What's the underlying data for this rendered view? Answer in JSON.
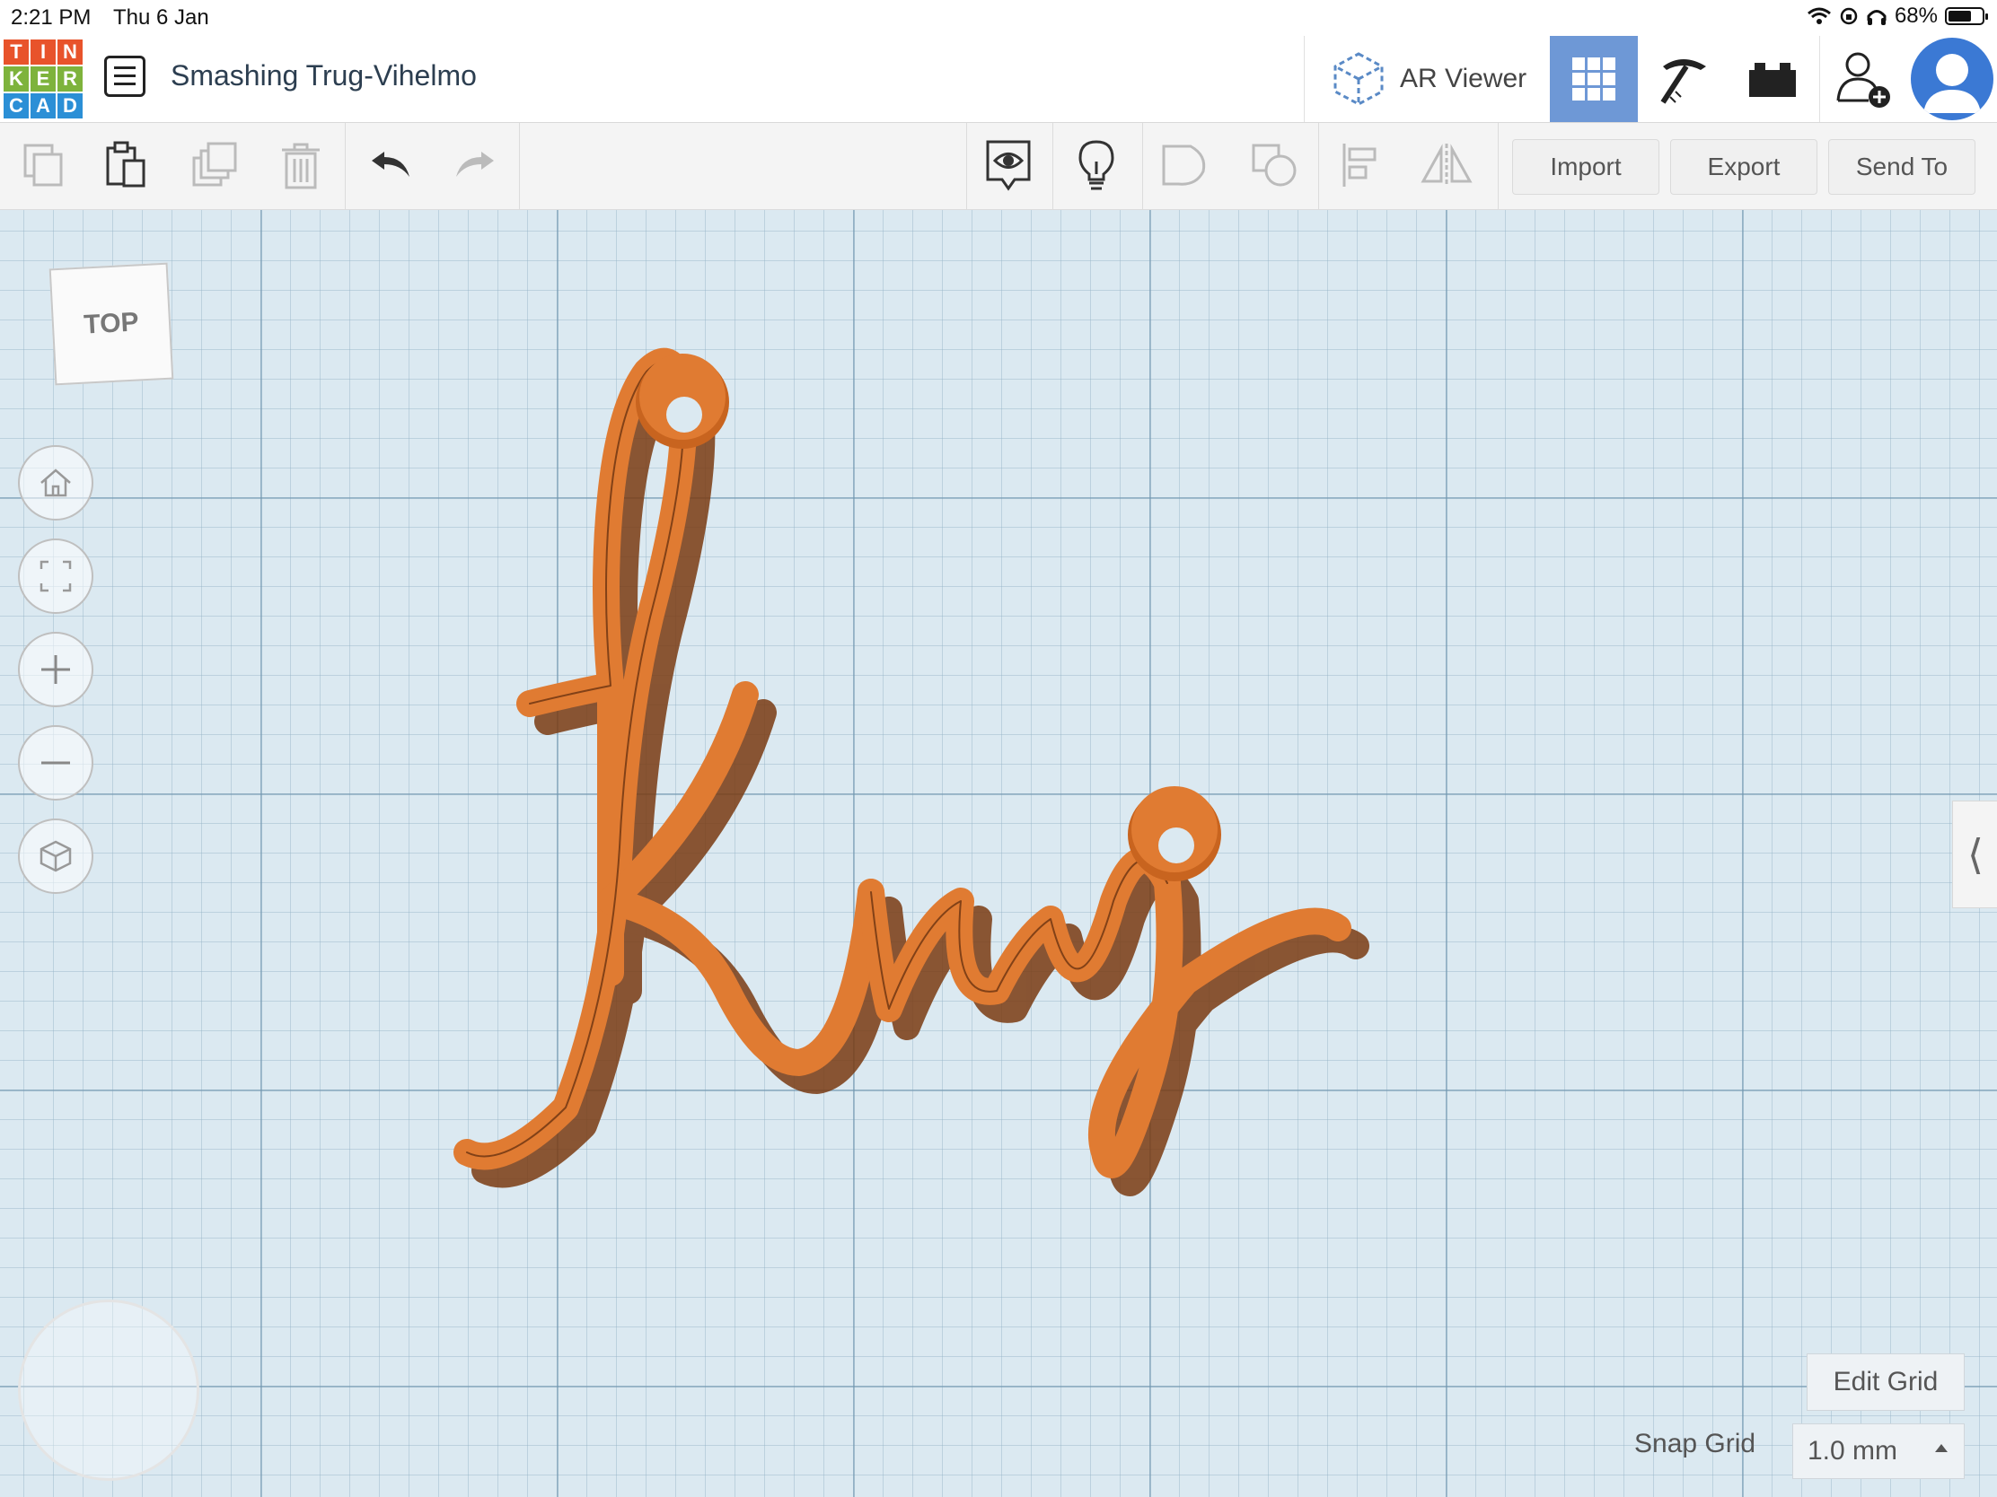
{
  "status_bar": {
    "time": "2:21 PM",
    "date": "Thu 6 Jan",
    "battery": "68%",
    "icons": [
      "wifi-icon",
      "orientation-lock-icon",
      "headphones-icon",
      "battery-icon"
    ]
  },
  "app": {
    "logo_letters": [
      "T",
      "I",
      "N",
      "K",
      "E",
      "R",
      "C",
      "A",
      "D"
    ],
    "logo_colors": [
      "#e8532b",
      "#e8532b",
      "#e8532b",
      "#7eb33c",
      "#7eb33c",
      "#7eb33c",
      "#2b8fd6",
      "#2b8fd6",
      "#2b8fd6"
    ],
    "project_title": "Smashing Trug-Vihelmo",
    "ar_viewer_label": "AR Viewer",
    "accent_color": "#6e98d6"
  },
  "toolbar": {
    "icons": [
      "copy-icon",
      "paste-icon",
      "duplicate-icon",
      "delete-icon",
      "undo-icon",
      "redo-icon",
      "show-all-icon",
      "notes-icon",
      "group-icon",
      "ungroup-icon",
      "align-icon",
      "mirror-icon"
    ],
    "import_label": "Import",
    "export_label": "Export",
    "send_to_label": "Send To"
  },
  "canvas": {
    "view_cube_label": "TOP",
    "model_text": "King",
    "model_color": "#e07b32",
    "edit_grid_label": "Edit Grid",
    "snap_grid_label": "Snap Grid",
    "snap_grid_value": "1.0 mm"
  }
}
